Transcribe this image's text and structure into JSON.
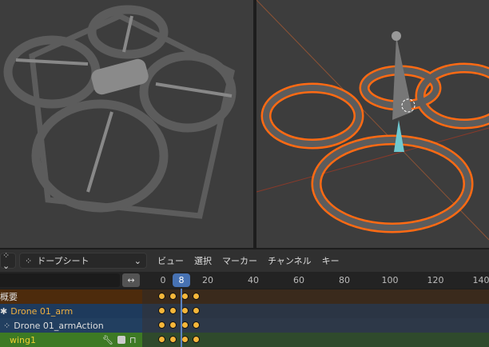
{
  "header": {
    "editor_type": "ドープシート",
    "menus": [
      "ビュー",
      "選択",
      "マーカー",
      "チャンネル",
      "キー"
    ]
  },
  "ruler": {
    "current_frame": "8",
    "ticks": [
      "0",
      "20",
      "40",
      "60",
      "80",
      "100",
      "120",
      "140"
    ],
    "swap_icon": "↔"
  },
  "channels": [
    {
      "label": "概要",
      "color": "#4d2b0c"
    },
    {
      "label": "Drone 01_arm",
      "color": "#1e3a5c"
    },
    {
      "label": "Drone 01_armAction",
      "color": "#223f60"
    },
    {
      "label": "wing1",
      "color": "#3d7a24"
    }
  ],
  "keyframes": [
    0,
    5,
    10,
    15
  ],
  "colors": {
    "accent": "#4772b3",
    "selection": "#ff6a13"
  }
}
